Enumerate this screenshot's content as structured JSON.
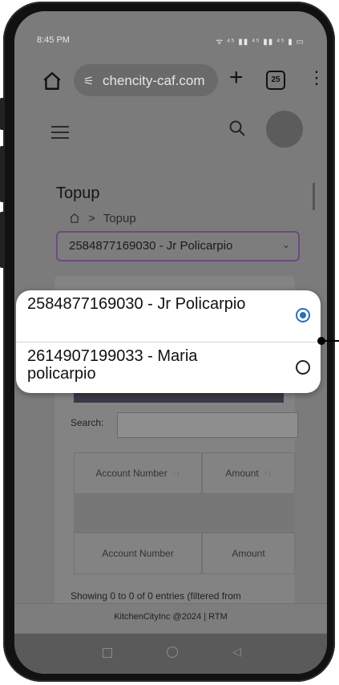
{
  "status_bar": {
    "time": "8:45 PM",
    "icons_right": "ᯤ ⁴⁵ ▮▮ ⁴⁵ ▮▮ ⁴⁵ ▮ ▭"
  },
  "browser": {
    "url": "chencity-caf.com",
    "tab_count": "25",
    "icons": [
      "home-icon",
      "site-settings-icon",
      "new-tab-icon",
      "tabs-icon",
      "more-menu-icon"
    ]
  },
  "header": {
    "icons": [
      "hamburger-icon",
      "search-icon",
      "avatar"
    ]
  },
  "page": {
    "title": "Topup",
    "breadcrumb": {
      "current": "Topup"
    },
    "account_select": {
      "value": "2584877169030 - Jr Policarpio"
    }
  },
  "table": {
    "search_label": "Search:",
    "search_value": "",
    "headers": [
      "Account Number",
      "Amount"
    ],
    "footers": [
      "Account Number",
      "Amount"
    ],
    "info": "Showing 0 to 0 of 0 entries (filtered from"
  },
  "footer": {
    "text": "KitchenCityInc @2024 | RTM"
  },
  "dropdown": {
    "options": [
      {
        "label": "2584877169030 - Jr Policarpio",
        "selected": true
      },
      {
        "label": "2614907199033 - Maria policarpio",
        "selected": false
      }
    ]
  },
  "colors": {
    "accent": "#2a6ebd",
    "select_border": "#6b4b80",
    "primary_button": "#2d4f86"
  }
}
